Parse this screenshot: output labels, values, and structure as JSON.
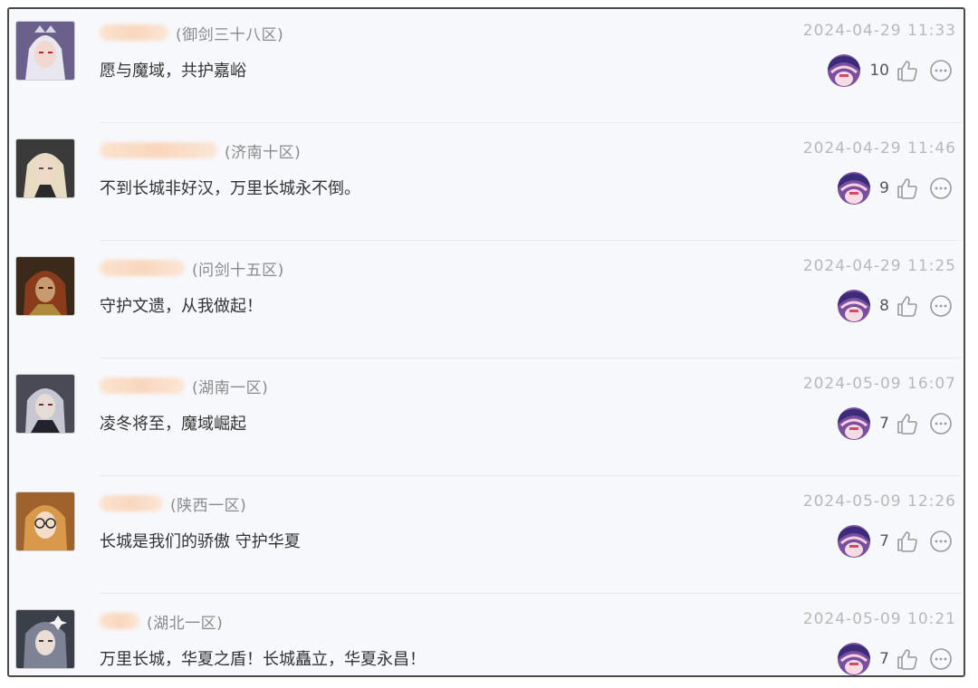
{
  "comments": [
    {
      "region": "(御剑三十八区)",
      "time": "2024-04-29 11:33",
      "text": "愿与魔域，共护嘉峪",
      "likes": "10",
      "avatar_icon": "white-haired-warrior-avatar",
      "avatar_color": "#6b5f8c"
    },
    {
      "region": "(济南十区)",
      "time": "2024-04-29 11:46",
      "text": "不到长城非好汉，万里长城永不倒。",
      "likes": "9",
      "avatar_icon": "blonde-warrior-avatar",
      "avatar_color": "#3a3a3a"
    },
    {
      "region": "(问剑十五区)",
      "time": "2024-04-29 11:25",
      "text": "守护文遗，从我做起！",
      "likes": "8",
      "avatar_icon": "red-haired-warrior-avatar",
      "avatar_color": "#3b2a1a"
    },
    {
      "region": "(湖南一区)",
      "time": "2024-05-09 16:07",
      "text": "凌冬将至，魔域崛起",
      "likes": "7",
      "avatar_icon": "silver-haired-warrior-avatar",
      "avatar_color": "#4a4a56"
    },
    {
      "region": "(陕西一区)",
      "time": "2024-05-09 12:26",
      "text": "长城是我们的骄傲 守护华夏",
      "likes": "7",
      "avatar_icon": "glasses-girl-avatar",
      "avatar_color": "#a0622c"
    },
    {
      "region": "(湖北一区)",
      "time": "2024-05-09 10:21",
      "text": "万里长城，华夏之盾！长城矗立，华夏永昌！",
      "likes": "7",
      "avatar_icon": "dark-haired-warrior-avatar",
      "avatar_color": "#3a3f4a"
    }
  ],
  "reactor_icon": "reactor-avatar",
  "like_icon": "thumbs-up-icon",
  "reply_icon": "comment-bubble-icon",
  "colors": {
    "border": "#4a4a4a",
    "background": "#f7f8fc",
    "timestamp": "#b8b8b8",
    "region": "#8a8a8a"
  }
}
